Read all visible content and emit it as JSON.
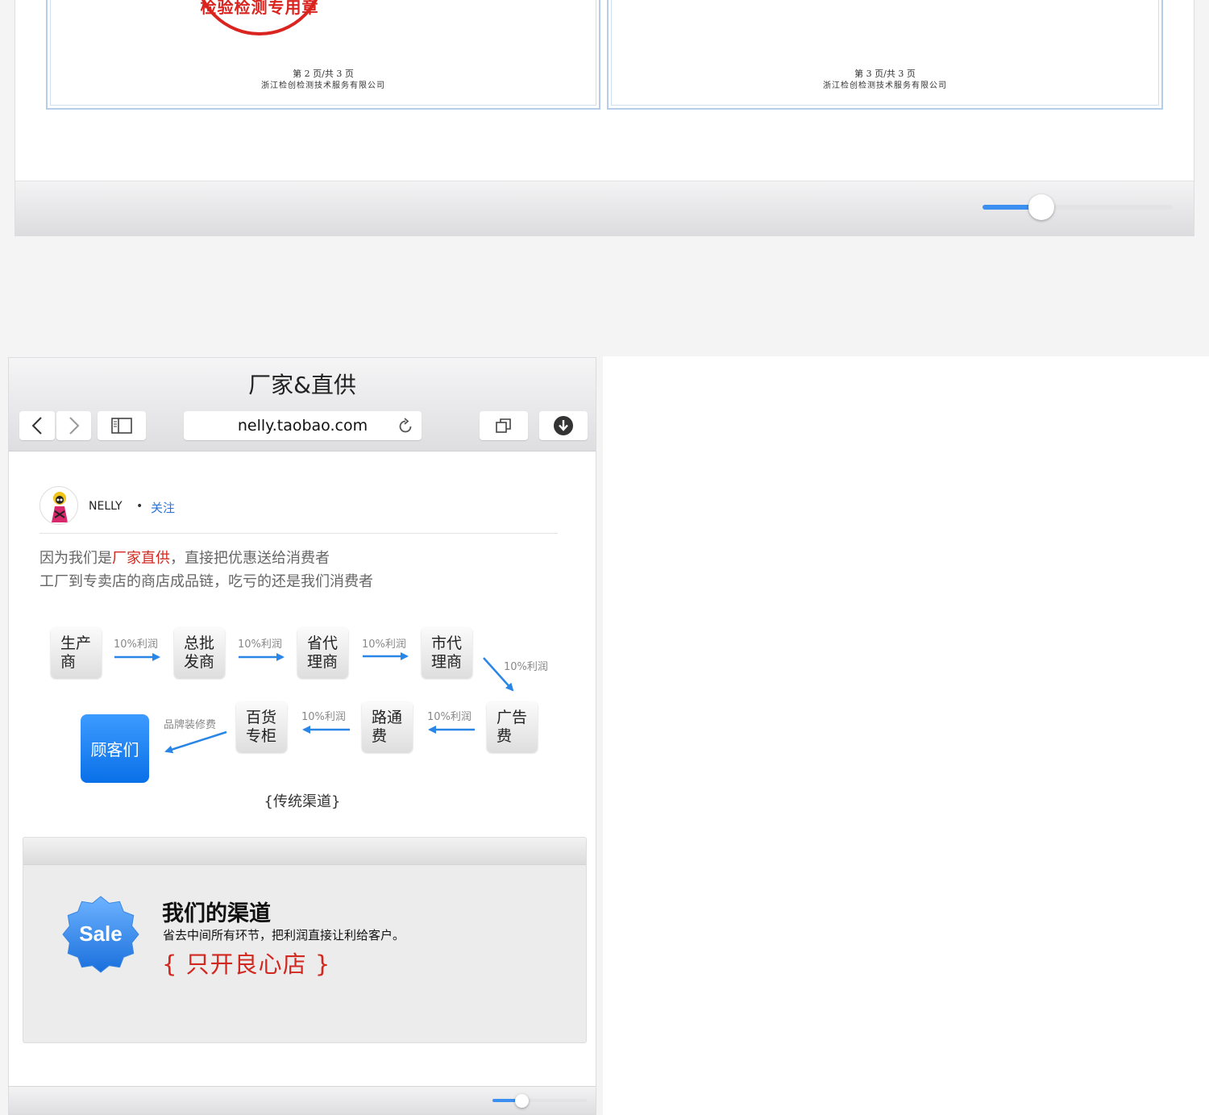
{
  "viewer_top": {
    "pages": [
      {
        "page_no": "第 2 页/共 3 页",
        "company": "浙江检创检测技术服务有限公司"
      },
      {
        "page_no": "第 3 页/共 3 页",
        "company": "浙江检创检测技术服务有限公司"
      }
    ],
    "seal_text": "检验检测专用章",
    "zoom_fraction": 0.31
  },
  "browser": {
    "title": "厂家&直供",
    "url": "nelly.taobao.com",
    "icons": [
      "chevron-left-icon",
      "chevron-right-icon",
      "sidebar-icon",
      "reload-icon",
      "tabs-icon",
      "download-icon"
    ],
    "zoom_fraction": 0.31
  },
  "profile": {
    "name": "NELLY",
    "separator": "•",
    "follow": "关注"
  },
  "intro": {
    "line1_pre": "因为我们是",
    "line1_highlight": "厂家直供",
    "line1_post": "，直接把优惠送给消费者",
    "line2": "工厂到专卖店的商店成品链，吃亏的还是我们消费者",
    "highlight_color": "#d2281f"
  },
  "flow": {
    "nodes": [
      {
        "l1": "生产",
        "l2": "商"
      },
      {
        "l1": "总批",
        "l2": "发商"
      },
      {
        "l1": "省代",
        "l2": "理商"
      },
      {
        "l1": "市代",
        "l2": "理商"
      },
      {
        "l1": "广告",
        "l2": "费"
      },
      {
        "l1": "路通",
        "l2": "费"
      },
      {
        "l1": "百货",
        "l2": "专柜"
      }
    ],
    "customer": "顾客们",
    "profit_label": "10%利润",
    "decor_label": "品牌装修费",
    "caption": "{传统渠道}",
    "arrow_color": "#2a86e6"
  },
  "promo": {
    "badge": "Sale",
    "title": "我们的渠道",
    "desc": "省去中间所有环节，把利润直接让利给客户。",
    "slogan": "{ 只开良心店 }"
  }
}
